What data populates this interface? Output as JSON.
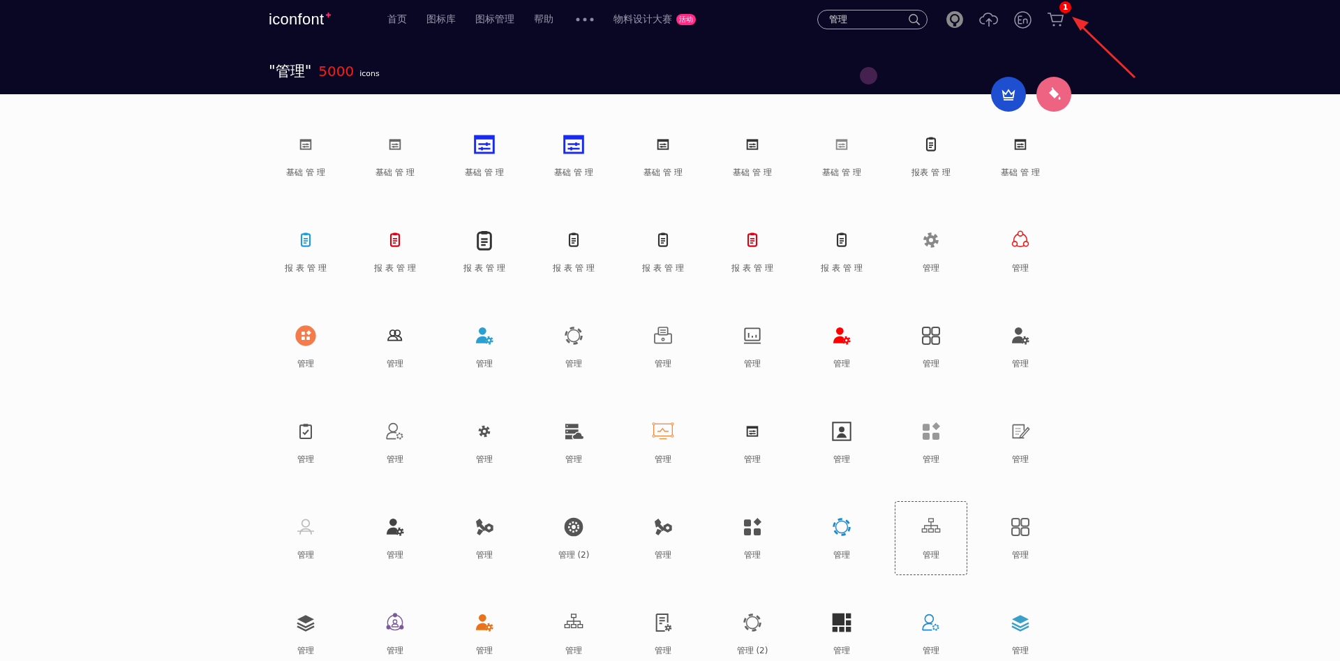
{
  "header": {
    "logo": "iconfont",
    "nav": [
      {
        "kind": "link",
        "label": "首页"
      },
      {
        "kind": "link",
        "label": "图标库"
      },
      {
        "kind": "link",
        "label": "图标管理"
      },
      {
        "kind": "link",
        "label": "帮助"
      },
      {
        "kind": "more"
      },
      {
        "kind": "link",
        "label": "物料设计大赛",
        "badge": "活动"
      }
    ],
    "search": {
      "value": "管理"
    },
    "cart_badge": "1"
  },
  "results": {
    "query": "\"管理\"",
    "count": "5000",
    "unit": "icons"
  },
  "icons": [
    {
      "label": "基础 管 理",
      "kind": "sliders-window",
      "color": "#666666",
      "hovered": false
    },
    {
      "label": "基础 管 理",
      "kind": "sliders-window",
      "color": "#666666",
      "hovered": false
    },
    {
      "label": "基础 管 理",
      "kind": "sliders-window-bold",
      "color": "#1a2bf0",
      "hovered": false
    },
    {
      "label": "基础 管 理",
      "kind": "sliders-window-bold",
      "color": "#1a2bf0",
      "hovered": false
    },
    {
      "label": "基础 管 理",
      "kind": "sliders-window",
      "color": "#333333",
      "hovered": false
    },
    {
      "label": "基础 管 理",
      "kind": "sliders-window",
      "color": "#333333",
      "hovered": false
    },
    {
      "label": "基础 管 理",
      "kind": "sliders-window",
      "color": "#888888",
      "hovered": false
    },
    {
      "label": "报表 管 理",
      "kind": "clipboard",
      "color": "#333333",
      "hovered": false
    },
    {
      "label": "基础 管 理",
      "kind": "sliders-window",
      "color": "#333333",
      "hovered": false
    },
    {
      "label": "报 表 管 理",
      "kind": "clipboard",
      "color": "#1e9be0",
      "hovered": false
    },
    {
      "label": "报 表 管 理",
      "kind": "clipboard",
      "color": "#e00012",
      "hovered": false
    },
    {
      "label": "报 表 管 理",
      "kind": "clipboard-bold",
      "color": "#333333",
      "hovered": false
    },
    {
      "label": "报 表 管 理",
      "kind": "clipboard",
      "color": "#333333",
      "hovered": false
    },
    {
      "label": "报 表 管 理",
      "kind": "clipboard",
      "color": "#333333",
      "hovered": false
    },
    {
      "label": "报 表 管 理",
      "kind": "clipboard",
      "color": "#e00012",
      "hovered": false
    },
    {
      "label": "报 表 管 理",
      "kind": "clipboard",
      "color": "#333333",
      "hovered": false
    },
    {
      "label": "管理",
      "kind": "gear-solid",
      "color": "#888888",
      "hovered": false
    },
    {
      "label": "管理",
      "kind": "network-circle",
      "color": "#e82020",
      "hovered": false
    },
    {
      "label": "管理",
      "kind": "app-circle",
      "color": "#f47c4a",
      "hovered": false
    },
    {
      "label": "管理",
      "kind": "users",
      "color": "#333333",
      "hovered": false
    },
    {
      "label": "管理",
      "kind": "user-gear",
      "color": "#2a9fd0",
      "hovered": false
    },
    {
      "label": "管理",
      "kind": "gear-outline",
      "color": "#666666",
      "hovered": false
    },
    {
      "label": "管理",
      "kind": "printer",
      "color": "#666666",
      "hovered": false
    },
    {
      "label": "管理",
      "kind": "monitor",
      "color": "#555555",
      "hovered": false
    },
    {
      "label": "管理",
      "kind": "user-gear",
      "color": "#ff0000",
      "hovered": false
    },
    {
      "label": "管理",
      "kind": "grid",
      "color": "#555555",
      "hovered": false
    },
    {
      "label": "管理",
      "kind": "user-gear",
      "color": "#555555",
      "hovered": false
    },
    {
      "label": "管理",
      "kind": "clipboard-check",
      "color": "#555555",
      "hovered": false
    },
    {
      "label": "管理",
      "kind": "user-outline-gear",
      "color": "#666666",
      "hovered": false
    },
    {
      "label": "管理",
      "kind": "gear-small",
      "color": "#555555",
      "hovered": false
    },
    {
      "label": "管理",
      "kind": "server-cloud",
      "color": "#555555",
      "hovered": false
    },
    {
      "label": "管理",
      "kind": "frame-chart",
      "color": "#f58a3c",
      "hovered": false
    },
    {
      "label": "管理",
      "kind": "sliders-window",
      "color": "#333333",
      "hovered": false
    },
    {
      "label": "管理",
      "kind": "person-frame",
      "color": "#444444",
      "hovered": false
    },
    {
      "label": "管理",
      "kind": "shapes",
      "color": "#999999",
      "hovered": false
    },
    {
      "label": "管理",
      "kind": "edit-list",
      "color": "#666666",
      "hovered": false
    },
    {
      "label": "管理",
      "kind": "person-outline",
      "color": "#bbbbbb",
      "hovered": false
    },
    {
      "label": "管理",
      "kind": "user-gear",
      "color": "#444444",
      "hovered": false
    },
    {
      "label": "管理",
      "kind": "wrench-nut",
      "color": "#555555",
      "hovered": false
    },
    {
      "label": "管理 (2)",
      "kind": "gear-circle",
      "color": "#555555",
      "hovered": false
    },
    {
      "label": "管理",
      "kind": "wrench-nut",
      "color": "#555555",
      "hovered": false
    },
    {
      "label": "管理",
      "kind": "shapes",
      "color": "#555555",
      "hovered": false
    },
    {
      "label": "管理",
      "kind": "gear-outline",
      "color": "#1a8ad4",
      "hovered": false
    },
    {
      "label": "管理",
      "kind": "tree",
      "color": "#666666",
      "hovered": true
    },
    {
      "label": "管理",
      "kind": "grid",
      "color": "#666666",
      "hovered": false
    },
    {
      "label": "管理",
      "kind": "layers",
      "color": "#555555",
      "hovered": false
    },
    {
      "label": "管理",
      "kind": "team-circle",
      "color": "#7a5a9a",
      "hovered": false
    },
    {
      "label": "管理",
      "kind": "user-gear",
      "color": "#e8731a",
      "hovered": false
    },
    {
      "label": "管理",
      "kind": "tree",
      "color": "#555555",
      "hovered": false
    },
    {
      "label": "管理",
      "kind": "doc-gear",
      "color": "#555555",
      "hovered": false
    },
    {
      "label": "管理 (2)",
      "kind": "gear-outline",
      "color": "#666666",
      "hovered": false
    },
    {
      "label": "管理",
      "kind": "tiles",
      "color": "#333333",
      "hovered": false
    },
    {
      "label": "管理",
      "kind": "user-outline-gear",
      "color": "#1a8ad4",
      "hovered": false
    },
    {
      "label": "管理",
      "kind": "layers",
      "color": "#3aa0c8",
      "hovered": false
    }
  ]
}
